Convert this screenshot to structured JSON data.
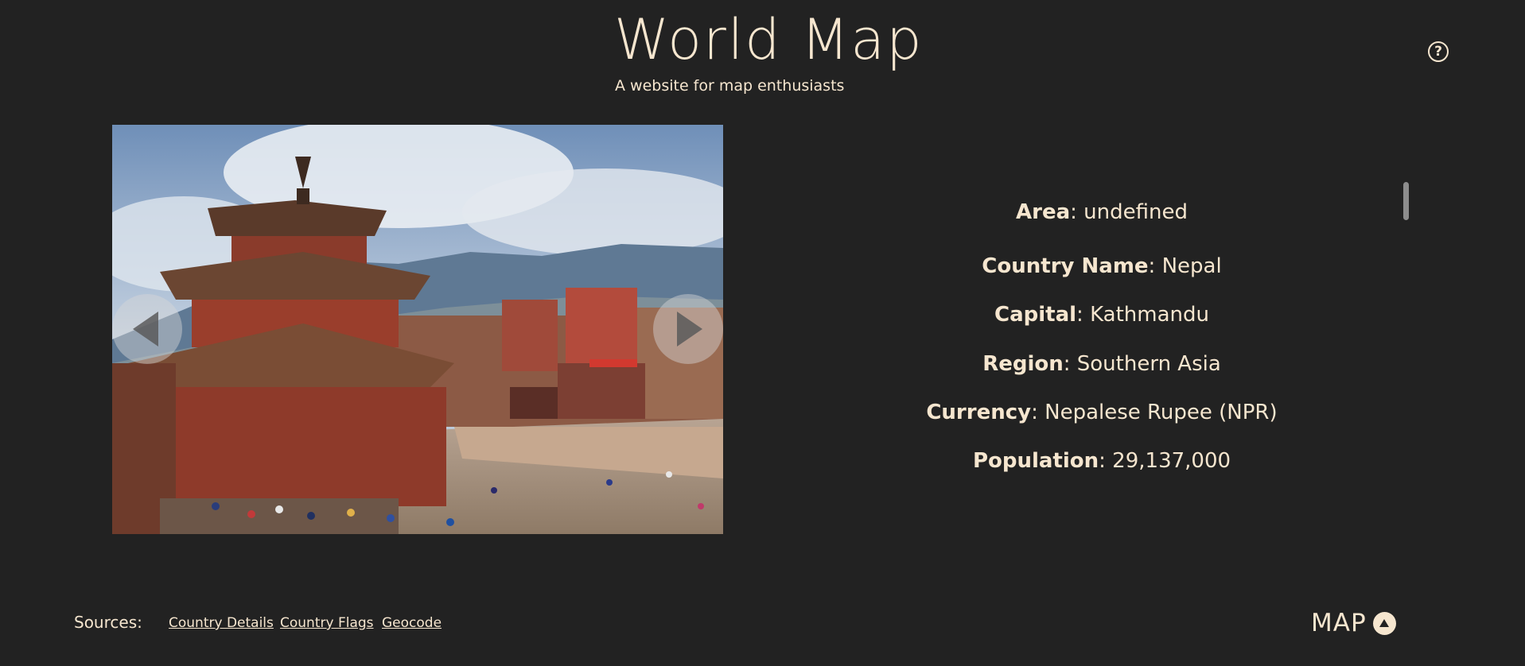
{
  "header": {
    "title": "World Map",
    "subtitle": "A website for map enthusiasts"
  },
  "help": {
    "symbol": "?"
  },
  "carousel": {
    "prev_icon": "chevron-left-icon",
    "next_icon": "chevron-right-icon"
  },
  "details": {
    "rows": [
      {
        "key": "Area",
        "value": ": undefined"
      },
      {
        "key": "Country Name",
        "value": ": Nepal"
      },
      {
        "key": "Capital",
        "value": ": Kathmandu"
      },
      {
        "key": "Region",
        "value": ": Southern Asia"
      },
      {
        "key": "Currency",
        "value": ": Nepalese Rupee (NPR)"
      },
      {
        "key": "Population",
        "value": ": 29,137,000"
      }
    ]
  },
  "footer": {
    "sources_label": "Sources:",
    "links": [
      "Country Details",
      "Country Flags",
      "Geocode"
    ],
    "map_button": "MAP",
    "map_icon": "arrow-up-circle-icon"
  },
  "colors": {
    "background": "#222222",
    "text": "#f6e6cf"
  }
}
